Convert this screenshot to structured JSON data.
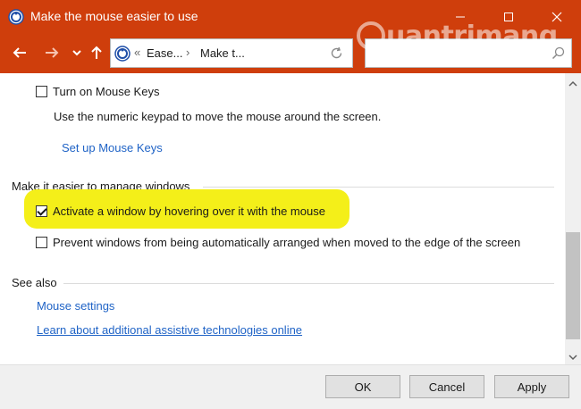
{
  "window": {
    "title": "Make the mouse easier to use"
  },
  "nav": {
    "breadcrumbs": [
      "Ease...",
      "Make t..."
    ],
    "chevron_prefix": "«",
    "chevron_sep": "›"
  },
  "content": {
    "mouse_keys": {
      "label": "Turn on Mouse Keys",
      "checked": false,
      "description": "Use the numeric keypad to move the mouse around the screen.",
      "setup_link": "Set up Mouse Keys"
    },
    "manage_windows": {
      "heading": "Make it easier to manage windows",
      "activate_hover_label": "Activate a window by hovering over it with the mouse",
      "activate_hover_checked": true,
      "prevent_arrange_label": "Prevent windows from being automatically arranged when moved to the edge of the screen",
      "prevent_arrange_checked": false
    },
    "see_also": {
      "heading": "See also",
      "links": [
        "Mouse settings",
        "Learn about additional assistive technologies online"
      ]
    }
  },
  "footer": {
    "ok_label": "OK",
    "cancel_label": "Cancel",
    "apply_label": "Apply"
  },
  "watermark": {
    "text": "uantrimang"
  },
  "colors": {
    "titlebar": "#cf3e0c",
    "link": "#1f63c6",
    "highlight": "#f4ef19"
  }
}
